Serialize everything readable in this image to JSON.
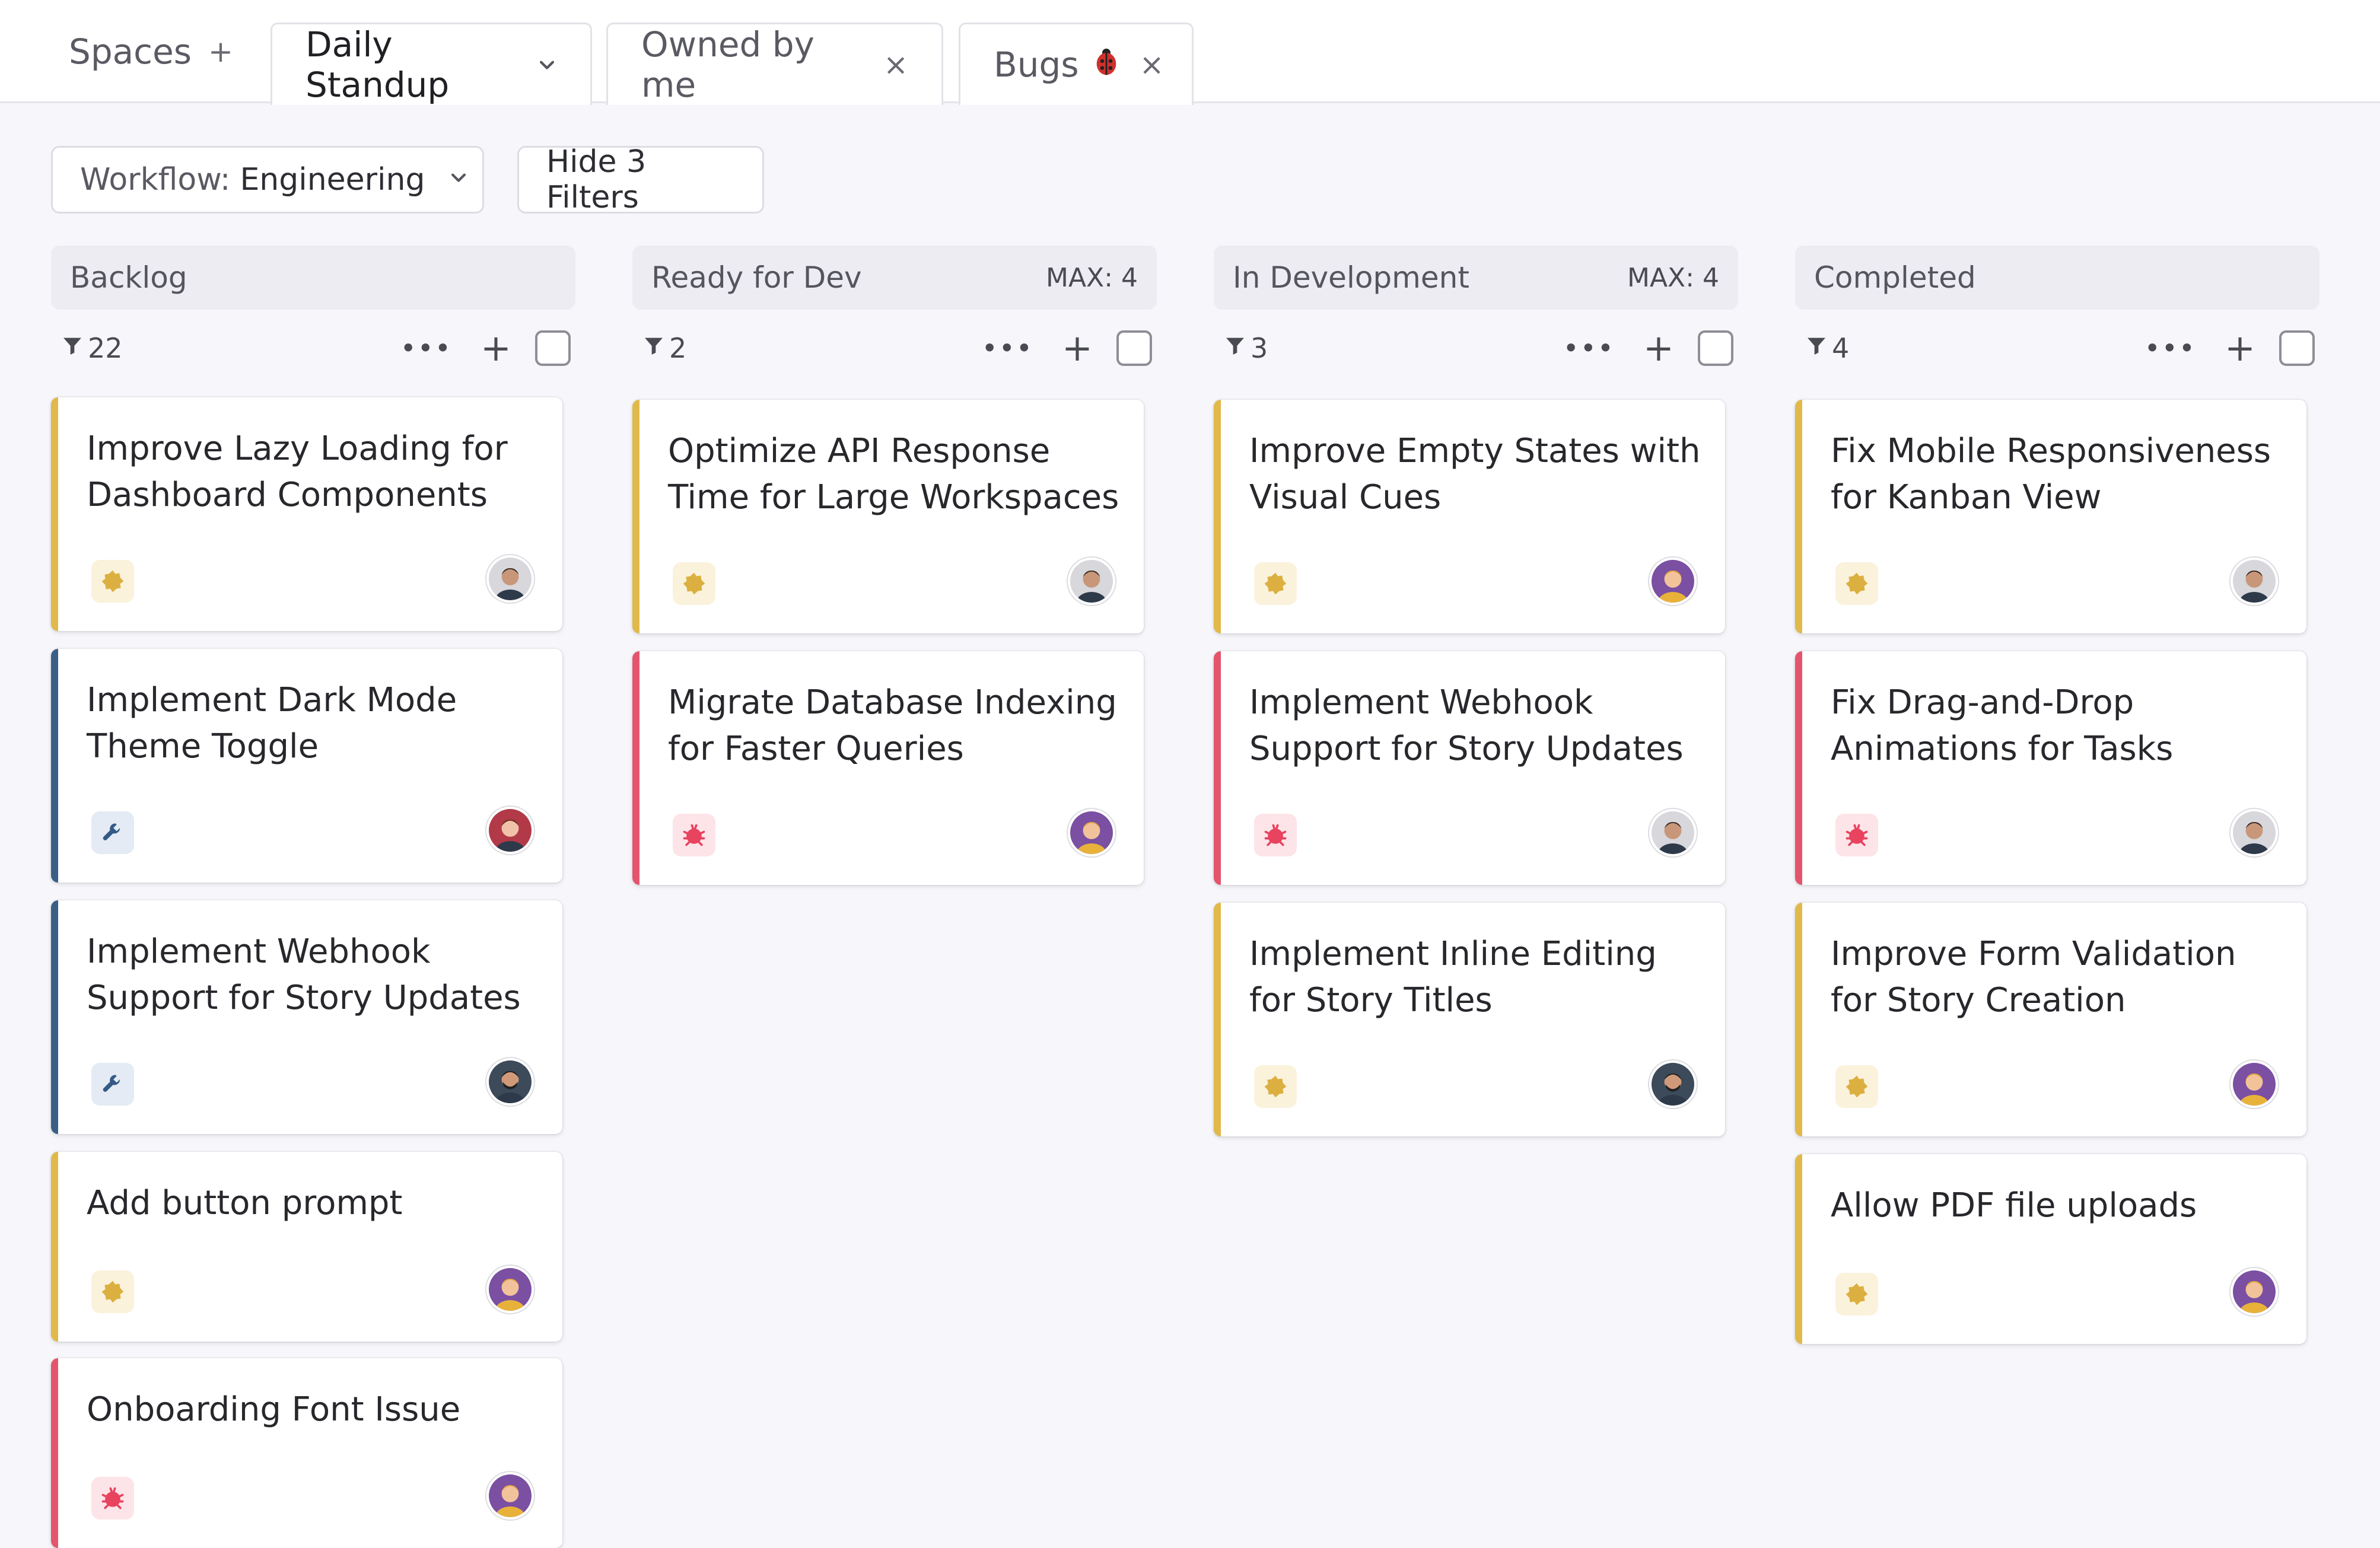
{
  "tabs": [
    {
      "label": "Spaces",
      "icon": "plus-icon",
      "glyph": "+"
    },
    {
      "label": "Daily Standup",
      "icon": "chevron-down-icon",
      "glyph": "⌄"
    },
    {
      "label": "Owned by me",
      "icon": "close-icon",
      "glyph": "×"
    },
    {
      "label": "Bugs",
      "icon": "close-icon",
      "glyph": "×",
      "emoji_icon": "ladybug-icon"
    }
  ],
  "toolbar": {
    "workflow_prefix": "Workflow:",
    "workflow_value": "Engineering",
    "filters_label": "Hide 3 Filters"
  },
  "colors": {
    "feature": "#e0b94a",
    "bug": "#e4556d",
    "task": "#3a5f87"
  },
  "columns": [
    {
      "title": "Backlog",
      "max": "",
      "count": "22",
      "cards": [
        {
          "title": "Improve Lazy Loading for Dashboard Components",
          "type": "feature",
          "avatar": "man-gray"
        },
        {
          "title": "Implement Dark Mode Theme Toggle",
          "type": "task",
          "avatar": "woman-red"
        },
        {
          "title": "Implement Webhook Support for Story Updates",
          "type": "task",
          "avatar": "man-beard"
        },
        {
          "title": "Add button prompt",
          "type": "feature",
          "avatar": "woman-purple"
        },
        {
          "title": "Onboarding Font Issue",
          "type": "bug",
          "avatar": "woman-purple"
        }
      ]
    },
    {
      "title": "Ready for Dev",
      "max": "MAX: 4",
      "count": "2",
      "cards": [
        {
          "title": "Optimize API Response Time for Large Workspaces",
          "type": "feature",
          "avatar": "man-gray"
        },
        {
          "title": "Migrate Database Indexing for Faster Queries",
          "type": "bug",
          "avatar": "woman-purple"
        }
      ]
    },
    {
      "title": "In Development",
      "max": "MAX: 4",
      "count": "3",
      "cards": [
        {
          "title": "Improve Empty States with Visual Cues",
          "type": "feature",
          "avatar": "woman-purple"
        },
        {
          "title": "Implement Webhook Support for Story Updates",
          "type": "bug",
          "avatar": "man-gray"
        },
        {
          "title": "Implement Inline Editing for Story Titles",
          "type": "feature",
          "avatar": "man-beard"
        }
      ]
    },
    {
      "title": "Completed",
      "max": "",
      "count": "4",
      "cards": [
        {
          "title": "Fix Mobile Responsiveness for Kanban View",
          "type": "feature",
          "avatar": "man-gray"
        },
        {
          "title": "Fix Drag-and-Drop Animations for Tasks",
          "type": "bug",
          "avatar": "man-gray"
        },
        {
          "title": "Improve Form Validation for Story Creation",
          "type": "feature",
          "avatar": "woman-purple"
        },
        {
          "title": "Allow PDF file uploads",
          "type": "feature",
          "avatar": "woman-purple"
        }
      ]
    }
  ]
}
